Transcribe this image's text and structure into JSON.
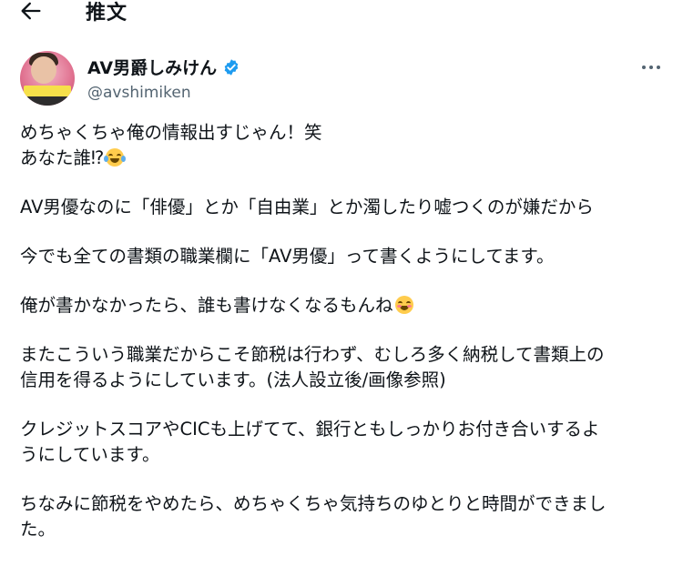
{
  "page": {
    "title": "推文",
    "back_icon": "arrow-left-icon"
  },
  "author": {
    "display_name": "AV男爵しみけん",
    "handle": "@avshimiken",
    "verified": true,
    "verified_color": "#1d9bf0"
  },
  "tweet": {
    "p1_line1": "めちゃくちゃ俺の情報出すじゃん！笑",
    "p1_line2": "あなた誰⁉",
    "p1_emoji": "face-with-tears-of-joy",
    "p2": "AV男優なのに「俳優」とか「自由業」とか濁したり嘘つくのが嫌だから",
    "p3": "今でも全ての書類の職業欄に「AV男優」って書くようにしてます。",
    "p4": "俺が書かなかったら、誰も書けなくなるもんね",
    "p4_emoji": "smiling-face-with-smiling-eyes",
    "p5_line1": "またこういう職業だからこそ節税は行わず、むしろ多く納税して書類上の",
    "p5_line2": "信用を得るようにしています。(法人設立後/画像参照)",
    "p6_line1": "クレジットスコアやCICも上げてて、銀行ともしっかりお付き合いするよ",
    "p6_line2": "うにしています。",
    "p7_line1": "ちなみに節税をやめたら、めちゃくちゃ気持ちのゆとりと時間ができまし",
    "p7_line2": "た。"
  },
  "colors": {
    "text": "#0f1419",
    "secondary": "#536471"
  }
}
